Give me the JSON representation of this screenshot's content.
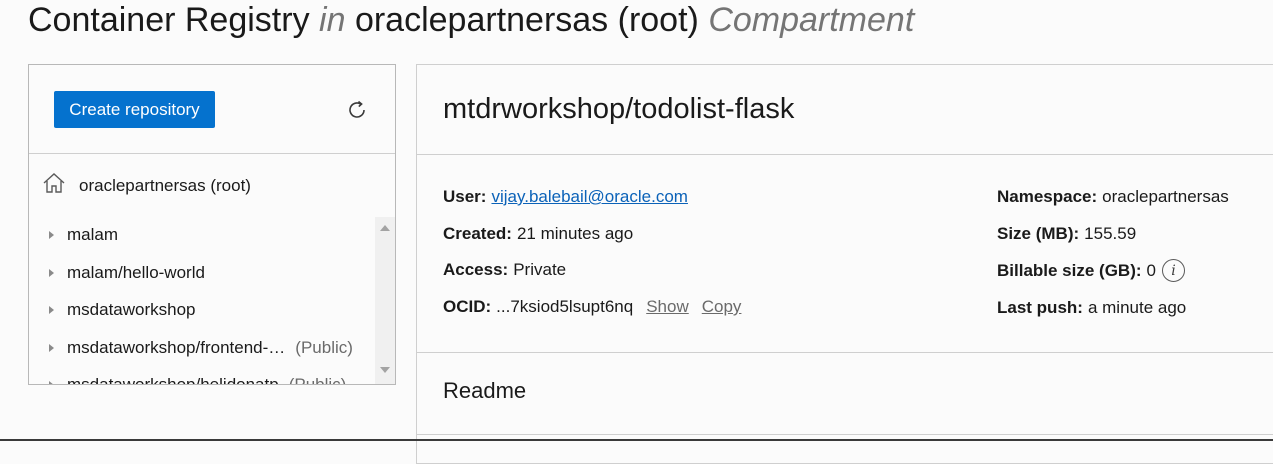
{
  "header": {
    "title": "Container Registry",
    "in_word": "in",
    "compartment_name": "oraclepartnersas (root)",
    "compartment_word": "Compartment"
  },
  "left_panel": {
    "create_button_label": "Create repository",
    "refresh_icon": "refresh-icon",
    "root_icon": "home-icon",
    "root_label": "oraclepartnersas (root)",
    "items": [
      {
        "label": "malam",
        "tag": ""
      },
      {
        "label": "malam/hello-world",
        "tag": ""
      },
      {
        "label": "msdataworkshop",
        "tag": ""
      },
      {
        "label": "msdataworkshop/frontend-…",
        "tag": "(Public)"
      },
      {
        "label": "msdataworkshop/helidonatp",
        "tag": "(Public)"
      }
    ]
  },
  "repo": {
    "title": "mtdrworkshop/todolist-flask",
    "user_label": "User:",
    "user_value": "vijay.balebail@oracle.com",
    "created_label": "Created:",
    "created_value": "21 minutes ago",
    "access_label": "Access:",
    "access_value": "Private",
    "ocid_label": "OCID:",
    "ocid_value": "...7ksiod5lsupt6nq",
    "show_label": "Show",
    "copy_label": "Copy",
    "namespace_label": "Namespace:",
    "namespace_value": "oraclepartnersas",
    "size_label": "Size (MB):",
    "size_value": "155.59",
    "billable_label": "Billable size (GB):",
    "billable_value": "0",
    "info_icon": "i",
    "last_push_label": "Last push:",
    "last_push_value": "a minute ago",
    "readme_label": "Readme"
  },
  "colors": {
    "primary": "#0572ce",
    "link": "#0b62b8",
    "muted": "#757575"
  }
}
